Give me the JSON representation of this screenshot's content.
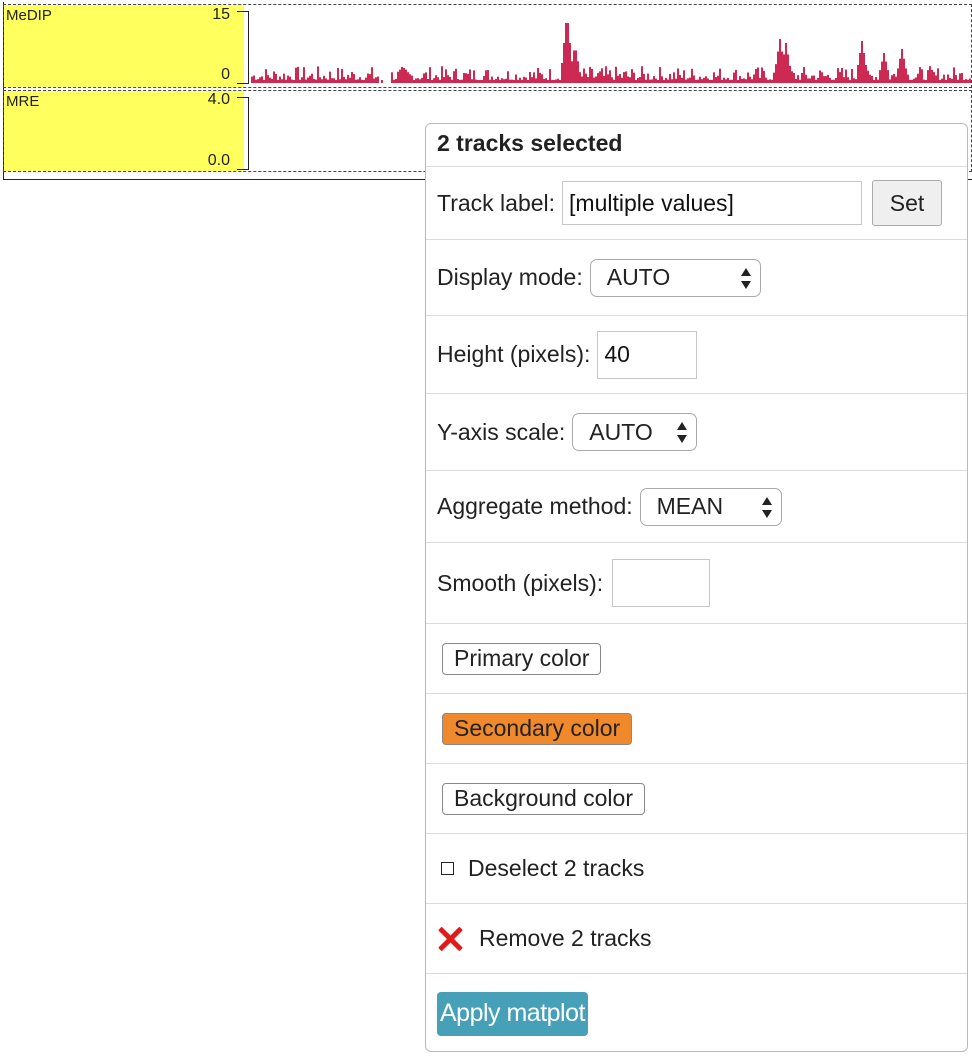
{
  "tracks": [
    {
      "name": "MeDIP",
      "max_label": "15",
      "min_label": "0",
      "color": "#cc2a52"
    },
    {
      "name": "MRE",
      "max_label": "4.0",
      "min_label": "0.0"
    }
  ],
  "label_bg": "#ffff5e",
  "popup": {
    "title": "2 tracks selected",
    "track_label": {
      "label": "Track label:",
      "value": "[multiple values]",
      "button": "Set"
    },
    "display_mode": {
      "label": "Display mode:",
      "value": "AUTO"
    },
    "height": {
      "label": "Height (pixels):",
      "value": "40"
    },
    "y_axis_scale": {
      "label": "Y-axis scale:",
      "value": "AUTO"
    },
    "aggregate": {
      "label": "Aggregate method:",
      "value": "MEAN"
    },
    "smooth": {
      "label": "Smooth (pixels):",
      "value": ""
    },
    "primary_color": {
      "label": "Primary color",
      "color": "#ffffff"
    },
    "secondary_color": {
      "label": "Secondary color",
      "color": "#f0892b"
    },
    "background_color": {
      "label": "Background color",
      "color": "#ffffff"
    },
    "deselect": "Deselect 2 tracks",
    "remove": "Remove 2 tracks",
    "apply": "Apply matplot",
    "apply_color": "#46a1b8"
  }
}
